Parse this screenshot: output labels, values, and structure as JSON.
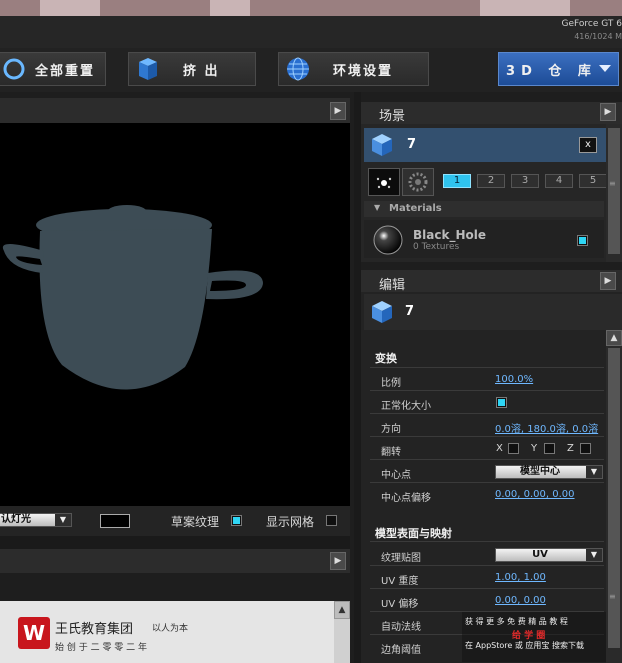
{
  "gpu": {
    "name": "GeForce GT 6",
    "memory": "416/1024 M"
  },
  "toolbar": {
    "reset_label": "全部重置",
    "extrude_label": "挤 出",
    "environment_label": "环境设置",
    "repository_label": "3D 仓 库"
  },
  "viewport": {
    "light_value": "认灯光",
    "pattern_texture_label": "草案纹理",
    "show_grid_label": "显示网格",
    "pattern_texture_checked": true,
    "show_grid_checked": false
  },
  "scene": {
    "title": "场景",
    "object_name": "7",
    "close_label": "x",
    "tabs": [
      "1",
      "2",
      "3",
      "4",
      "5"
    ],
    "active_tab": 0,
    "materials_label": "Materials",
    "material_name": "Black_Hole",
    "material_textures": "0 Textures"
  },
  "edit": {
    "title": "编辑",
    "object_name": "7",
    "transform_section": "变换",
    "scale_label": "比例",
    "scale_value": "100.0%",
    "normalize_label": "正常化大小",
    "direction_label": "方向",
    "direction_value": "0.0溶, 180.0溶, 0.0溶",
    "flip_label": "翻转",
    "flip_x": "X",
    "flip_y": "Y",
    "flip_z": "Z",
    "pivot_label": "中心点",
    "pivot_value": "模型中心",
    "pivot_offset_label": "中心点偏移",
    "pivot_offset_value": "0.00, 0.00, 0.00",
    "surface_section": "模型表面与映射",
    "texture_map_label": "纹理贴图",
    "texture_map_value": "UV",
    "uv_scale_label": "UV 重度",
    "uv_scale_value": "1.00, 1.00",
    "uv_offset_label": "UV 偏移",
    "uv_offset_value": "0.00, 0.00",
    "auto_normals_label": "自动法线",
    "edge_threshold_label": "边角阈值"
  },
  "watermark": {
    "company": "王氏教育集团",
    "motto": "以人为本",
    "founded": "始 创 于 二 零 零 二 年",
    "promo_line1": "获 得 更 多 免 费 精 品 教 程",
    "promo_line2": "给 学 圈",
    "promo_line3": "在 AppStore 或 应用宝 搜索下载"
  },
  "colors": {
    "accent": "#2fd6f5",
    "link": "#6fb8ff",
    "object": "#3d4c55"
  }
}
